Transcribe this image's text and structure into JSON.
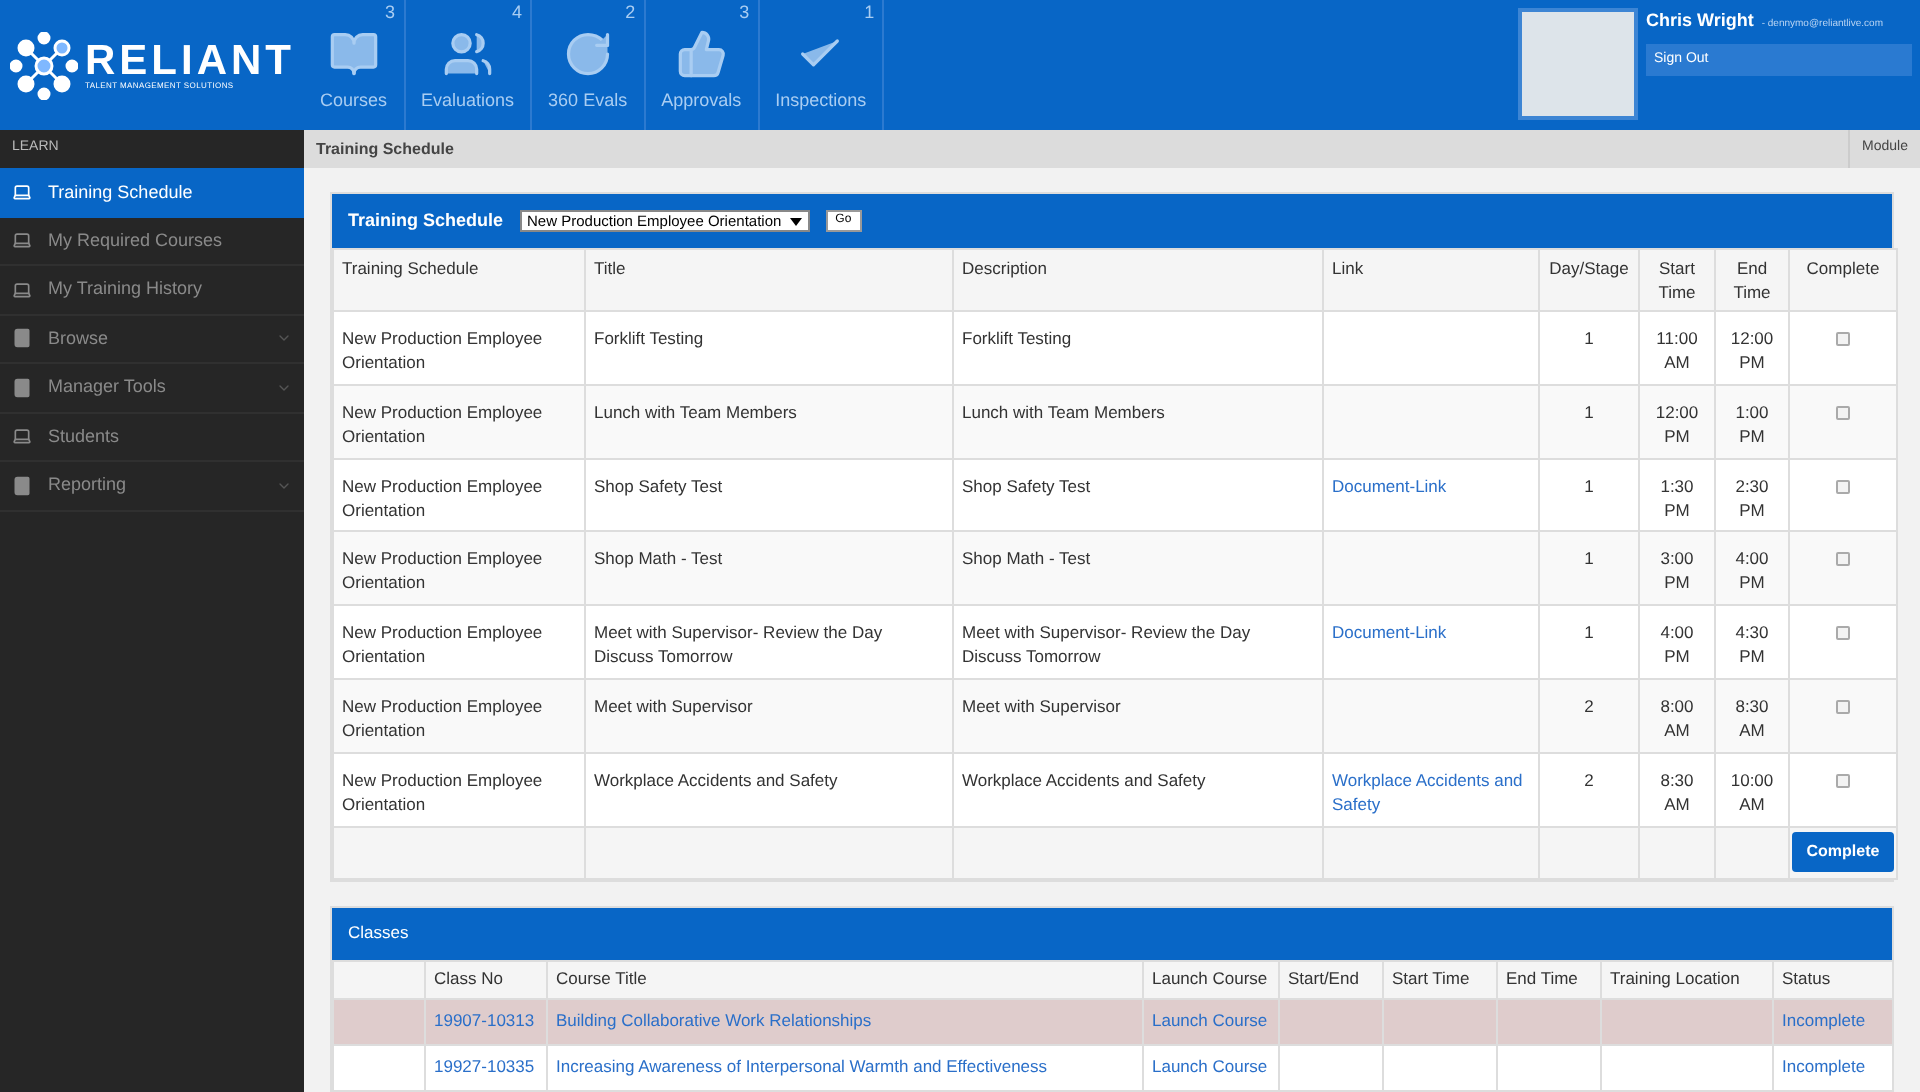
{
  "logo": {
    "name": "RELIANT",
    "tagline": "TALENT MANAGEMENT SOLUTIONS"
  },
  "nav": [
    {
      "label": "Courses",
      "count": "3"
    },
    {
      "label": "Evaluations",
      "count": "4"
    },
    {
      "label": "360 Evals",
      "count": "2"
    },
    {
      "label": "Approvals",
      "count": "3"
    },
    {
      "label": "Inspections",
      "count": "1"
    }
  ],
  "user": {
    "name": "Chris Wright",
    "email": "- dennymo@reliantlive.com",
    "sign_out": "Sign Out"
  },
  "sidebar": {
    "heading": "LEARN",
    "items": [
      {
        "label": "Training Schedule",
        "kind": "link",
        "selected": true
      },
      {
        "label": "My Required Courses",
        "kind": "link",
        "selected": false
      },
      {
        "label": "My Training History",
        "kind": "link",
        "selected": false
      },
      {
        "label": "Browse",
        "kind": "group",
        "selected": false
      },
      {
        "label": "Manager Tools",
        "kind": "group",
        "selected": false
      },
      {
        "label": "Students",
        "kind": "link",
        "selected": false
      },
      {
        "label": "Reporting",
        "kind": "group",
        "selected": false
      }
    ]
  },
  "breadcrumb": {
    "title": "Training Schedule",
    "module": "Module"
  },
  "schedule": {
    "title": "Training Schedule",
    "select_value": "New Production Employee Orientation",
    "go": "Go",
    "columns": [
      "Training Schedule",
      "Title",
      "Description",
      "Link",
      "Day/Stage",
      "Start Time",
      "End Time",
      "Complete"
    ],
    "rows": [
      {
        "schedule": "New Production Employee Orientation",
        "title": "Forklift Testing",
        "description": "Forklift Testing",
        "link": "",
        "day": "1",
        "start": "11:00 AM",
        "end": "12:00 PM",
        "checked": false
      },
      {
        "schedule": "New Production Employee Orientation",
        "title": "Lunch with Team Members",
        "description": "Lunch with Team Members",
        "link": "",
        "day": "1",
        "start": "12:00 PM",
        "end": "1:00 PM",
        "checked": false
      },
      {
        "schedule": "New Production Employee Orientation",
        "title": "Shop Safety Test",
        "description": "Shop Safety Test",
        "link": "Document-Link",
        "day": "1",
        "start": "1:30 PM",
        "end": "2:30 PM",
        "checked": false
      },
      {
        "schedule": "New Production Employee Orientation",
        "title": "Shop Math - Test",
        "description": "Shop Math - Test",
        "link": "",
        "day": "1",
        "start": "3:00 PM",
        "end": "4:00 PM",
        "checked": false
      },
      {
        "schedule": "New Production Employee Orientation",
        "title": "Meet with Supervisor- Review the Day Discuss Tomorrow",
        "description": "Meet with Supervisor- Review the Day Discuss Tomorrow",
        "link": "Document-Link",
        "day": "1",
        "start": "4:00 PM",
        "end": "4:30 PM",
        "checked": false
      },
      {
        "schedule": "New Production Employee Orientation",
        "title": "Meet with Supervisor",
        "description": "Meet with Supervisor",
        "link": "",
        "day": "2",
        "start": "8:00 AM",
        "end": "8:30 AM",
        "checked": false
      },
      {
        "schedule": "New Production Employee Orientation",
        "title": "Workplace Accidents and Safety",
        "description": "Workplace Accidents and Safety",
        "link": "Workplace Accidents and Safety",
        "day": "2",
        "start": "8:30 AM",
        "end": "10:00 AM",
        "checked": false
      }
    ],
    "complete_button": "Complete"
  },
  "classes": {
    "title": "Classes",
    "columns": [
      "Class No",
      "Course Title",
      "Launch Course",
      "Start/End",
      "Start Time",
      "End Time",
      "Training Location",
      "Status"
    ],
    "rows": [
      {
        "class_no": "19907-10313",
        "course_title": "Building Collaborative Work Relationships",
        "launch": "Launch Course",
        "status": "Incomplete",
        "selected": true
      },
      {
        "class_no": "19927-10335",
        "course_title": "Increasing Awareness of Interpersonal Warmth and Effectiveness",
        "launch": "Launch Course",
        "status": "Incomplete",
        "selected": false
      }
    ]
  }
}
